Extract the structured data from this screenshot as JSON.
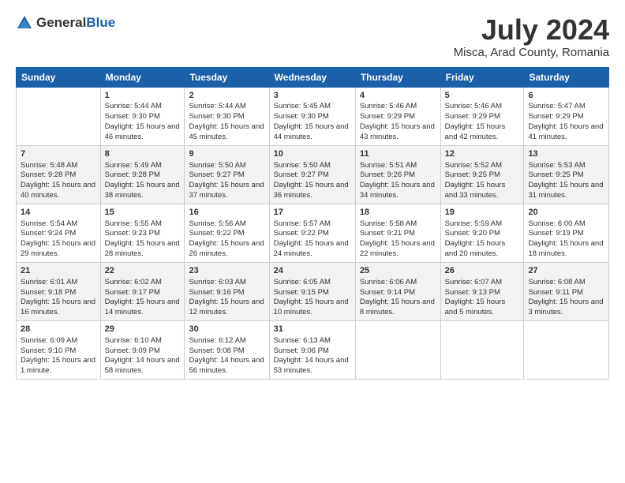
{
  "logo": {
    "general": "General",
    "blue": "Blue"
  },
  "title": "July 2024",
  "subtitle": "Misca, Arad County, Romania",
  "days_header": [
    "Sunday",
    "Monday",
    "Tuesday",
    "Wednesday",
    "Thursday",
    "Friday",
    "Saturday"
  ],
  "weeks": [
    [
      {
        "day": "",
        "sunrise": "",
        "sunset": "",
        "daylight": ""
      },
      {
        "day": "1",
        "sunrise": "Sunrise: 5:44 AM",
        "sunset": "Sunset: 9:30 PM",
        "daylight": "Daylight: 15 hours and 46 minutes."
      },
      {
        "day": "2",
        "sunrise": "Sunrise: 5:44 AM",
        "sunset": "Sunset: 9:30 PM",
        "daylight": "Daylight: 15 hours and 45 minutes."
      },
      {
        "day": "3",
        "sunrise": "Sunrise: 5:45 AM",
        "sunset": "Sunset: 9:30 PM",
        "daylight": "Daylight: 15 hours and 44 minutes."
      },
      {
        "day": "4",
        "sunrise": "Sunrise: 5:46 AM",
        "sunset": "Sunset: 9:29 PM",
        "daylight": "Daylight: 15 hours and 43 minutes."
      },
      {
        "day": "5",
        "sunrise": "Sunrise: 5:46 AM",
        "sunset": "Sunset: 9:29 PM",
        "daylight": "Daylight: 15 hours and 42 minutes."
      },
      {
        "day": "6",
        "sunrise": "Sunrise: 5:47 AM",
        "sunset": "Sunset: 9:29 PM",
        "daylight": "Daylight: 15 hours and 41 minutes."
      }
    ],
    [
      {
        "day": "7",
        "sunrise": "Sunrise: 5:48 AM",
        "sunset": "Sunset: 9:28 PM",
        "daylight": "Daylight: 15 hours and 40 minutes."
      },
      {
        "day": "8",
        "sunrise": "Sunrise: 5:49 AM",
        "sunset": "Sunset: 9:28 PM",
        "daylight": "Daylight: 15 hours and 38 minutes."
      },
      {
        "day": "9",
        "sunrise": "Sunrise: 5:50 AM",
        "sunset": "Sunset: 9:27 PM",
        "daylight": "Daylight: 15 hours and 37 minutes."
      },
      {
        "day": "10",
        "sunrise": "Sunrise: 5:50 AM",
        "sunset": "Sunset: 9:27 PM",
        "daylight": "Daylight: 15 hours and 36 minutes."
      },
      {
        "day": "11",
        "sunrise": "Sunrise: 5:51 AM",
        "sunset": "Sunset: 9:26 PM",
        "daylight": "Daylight: 15 hours and 34 minutes."
      },
      {
        "day": "12",
        "sunrise": "Sunrise: 5:52 AM",
        "sunset": "Sunset: 9:25 PM",
        "daylight": "Daylight: 15 hours and 33 minutes."
      },
      {
        "day": "13",
        "sunrise": "Sunrise: 5:53 AM",
        "sunset": "Sunset: 9:25 PM",
        "daylight": "Daylight: 15 hours and 31 minutes."
      }
    ],
    [
      {
        "day": "14",
        "sunrise": "Sunrise: 5:54 AM",
        "sunset": "Sunset: 9:24 PM",
        "daylight": "Daylight: 15 hours and 29 minutes."
      },
      {
        "day": "15",
        "sunrise": "Sunrise: 5:55 AM",
        "sunset": "Sunset: 9:23 PM",
        "daylight": "Daylight: 15 hours and 28 minutes."
      },
      {
        "day": "16",
        "sunrise": "Sunrise: 5:56 AM",
        "sunset": "Sunset: 9:22 PM",
        "daylight": "Daylight: 15 hours and 26 minutes."
      },
      {
        "day": "17",
        "sunrise": "Sunrise: 5:57 AM",
        "sunset": "Sunset: 9:22 PM",
        "daylight": "Daylight: 15 hours and 24 minutes."
      },
      {
        "day": "18",
        "sunrise": "Sunrise: 5:58 AM",
        "sunset": "Sunset: 9:21 PM",
        "daylight": "Daylight: 15 hours and 22 minutes."
      },
      {
        "day": "19",
        "sunrise": "Sunrise: 5:59 AM",
        "sunset": "Sunset: 9:20 PM",
        "daylight": "Daylight: 15 hours and 20 minutes."
      },
      {
        "day": "20",
        "sunrise": "Sunrise: 6:00 AM",
        "sunset": "Sunset: 9:19 PM",
        "daylight": "Daylight: 15 hours and 18 minutes."
      }
    ],
    [
      {
        "day": "21",
        "sunrise": "Sunrise: 6:01 AM",
        "sunset": "Sunset: 9:18 PM",
        "daylight": "Daylight: 15 hours and 16 minutes."
      },
      {
        "day": "22",
        "sunrise": "Sunrise: 6:02 AM",
        "sunset": "Sunset: 9:17 PM",
        "daylight": "Daylight: 15 hours and 14 minutes."
      },
      {
        "day": "23",
        "sunrise": "Sunrise: 6:03 AM",
        "sunset": "Sunset: 9:16 PM",
        "daylight": "Daylight: 15 hours and 12 minutes."
      },
      {
        "day": "24",
        "sunrise": "Sunrise: 6:05 AM",
        "sunset": "Sunset: 9:15 PM",
        "daylight": "Daylight: 15 hours and 10 minutes."
      },
      {
        "day": "25",
        "sunrise": "Sunrise: 6:06 AM",
        "sunset": "Sunset: 9:14 PM",
        "daylight": "Daylight: 15 hours and 8 minutes."
      },
      {
        "day": "26",
        "sunrise": "Sunrise: 6:07 AM",
        "sunset": "Sunset: 9:13 PM",
        "daylight": "Daylight: 15 hours and 5 minutes."
      },
      {
        "day": "27",
        "sunrise": "Sunrise: 6:08 AM",
        "sunset": "Sunset: 9:11 PM",
        "daylight": "Daylight: 15 hours and 3 minutes."
      }
    ],
    [
      {
        "day": "28",
        "sunrise": "Sunrise: 6:09 AM",
        "sunset": "Sunset: 9:10 PM",
        "daylight": "Daylight: 15 hours and 1 minute."
      },
      {
        "day": "29",
        "sunrise": "Sunrise: 6:10 AM",
        "sunset": "Sunset: 9:09 PM",
        "daylight": "Daylight: 14 hours and 58 minutes."
      },
      {
        "day": "30",
        "sunrise": "Sunrise: 6:12 AM",
        "sunset": "Sunset: 9:08 PM",
        "daylight": "Daylight: 14 hours and 56 minutes."
      },
      {
        "day": "31",
        "sunrise": "Sunrise: 6:13 AM",
        "sunset": "Sunset: 9:06 PM",
        "daylight": "Daylight: 14 hours and 53 minutes."
      },
      {
        "day": "",
        "sunrise": "",
        "sunset": "",
        "daylight": ""
      },
      {
        "day": "",
        "sunrise": "",
        "sunset": "",
        "daylight": ""
      },
      {
        "day": "",
        "sunrise": "",
        "sunset": "",
        "daylight": ""
      }
    ]
  ]
}
